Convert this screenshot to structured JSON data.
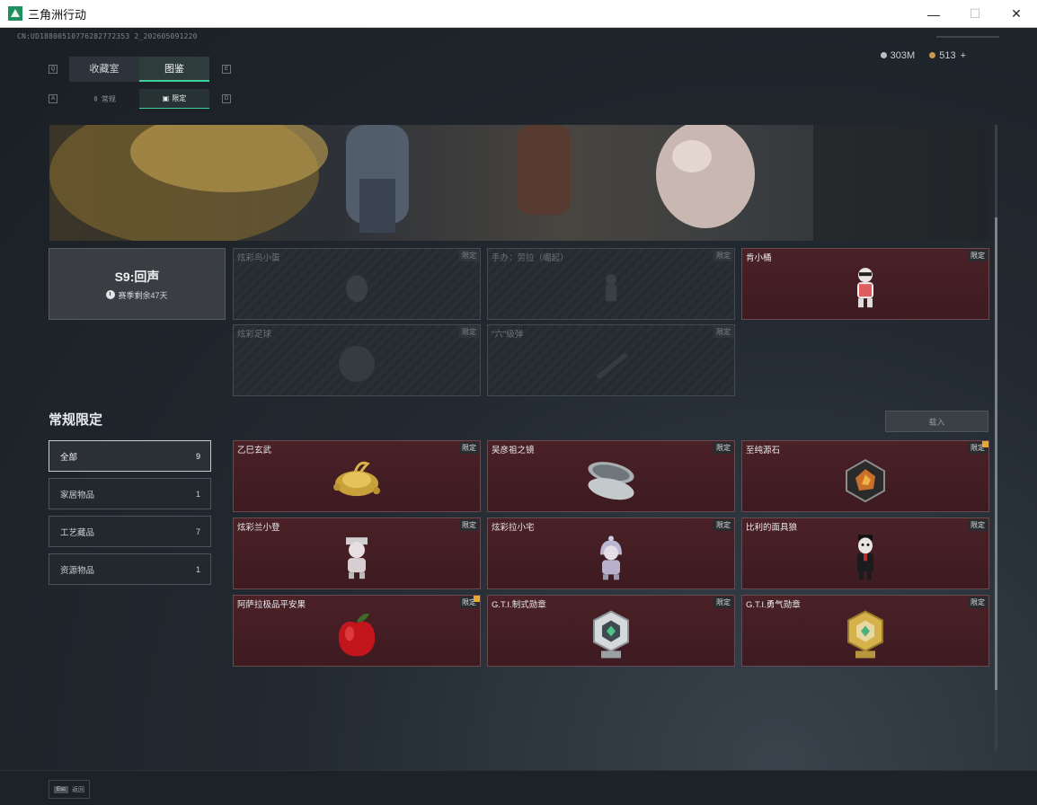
{
  "window": {
    "title": "三角洲行动",
    "minimize": "—",
    "maximize": "☐",
    "close": "✕"
  },
  "uid": "CN:UD18800510776282772353 2_202605091220",
  "currency": {
    "silver": "303M",
    "gold": "513",
    "plus": "+"
  },
  "hint_keys": {
    "q": "Q",
    "e": "E",
    "a": "A",
    "d": "D"
  },
  "main_tabs": [
    {
      "label": "收藏室"
    },
    {
      "label": "图鉴"
    }
  ],
  "sub_tabs": [
    {
      "label": "常规"
    },
    {
      "label": "限定"
    }
  ],
  "season": {
    "title": "S9:回声",
    "remain": "赛季剩余47天"
  },
  "badge_label": "限定",
  "season_items": [
    {
      "name": "炫彩鸟小蛋",
      "locked": true
    },
    {
      "name": "手办：劳拉（崛起）",
      "locked": true
    },
    {
      "name": "肯小桶",
      "locked": false
    },
    {
      "name": "炫彩足球",
      "locked": true
    },
    {
      "name": "\"六\"级弹",
      "locked": true
    }
  ],
  "section_title": "常规限定",
  "load_button": "载入",
  "filters": [
    {
      "label": "全部",
      "count": "9"
    },
    {
      "label": "家居物品",
      "count": "1"
    },
    {
      "label": "工艺藏品",
      "count": "7"
    },
    {
      "label": "资源物品",
      "count": "1"
    }
  ],
  "regular_items": [
    {
      "name": "乙巳玄武",
      "alert": false,
      "icon": "gold-tortoise-icon"
    },
    {
      "name": "吴彦祖之镜",
      "alert": false,
      "icon": "compact-mirror-icon"
    },
    {
      "name": "至纯源石",
      "alert": true,
      "icon": "source-stone-icon"
    },
    {
      "name": "炫彩兰小登",
      "alert": false,
      "icon": "figurine-icon"
    },
    {
      "name": "炫彩拉小宅",
      "alert": false,
      "icon": "hooded-figurine-icon"
    },
    {
      "name": "比利的面具狼",
      "alert": false,
      "icon": "puppet-icon"
    },
    {
      "name": "阿萨拉极品平安果",
      "alert": true,
      "icon": "apple-icon"
    },
    {
      "name": "G.T.I.制式勋章",
      "alert": false,
      "icon": "silver-medal-icon"
    },
    {
      "name": "G.T.I.勇气勋章",
      "alert": false,
      "icon": "gold-medal-icon"
    }
  ],
  "bottom": {
    "esc_key": "Esc",
    "back_label": "返回"
  },
  "colors": {
    "accent": "#3fcf9a",
    "card_red": "#4a2127",
    "alert": "#e5a92e"
  }
}
